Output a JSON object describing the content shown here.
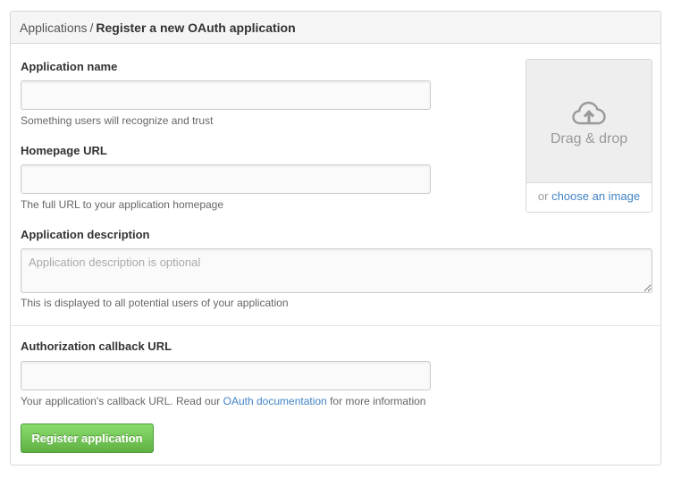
{
  "header": {
    "breadcrumb_parent": "Applications",
    "breadcrumb_separator": "/",
    "breadcrumb_current": "Register a new OAuth application"
  },
  "form": {
    "app_name": {
      "label": "Application name",
      "value": "",
      "placeholder": "",
      "note": "Something users will recognize and trust"
    },
    "homepage_url": {
      "label": "Homepage URL",
      "value": "",
      "placeholder": "",
      "note": "The full URL to your application homepage"
    },
    "description": {
      "label": "Application description",
      "value": "",
      "placeholder": "Application description is optional",
      "note": "This is displayed to all potential users of your application"
    },
    "callback_url": {
      "label": "Authorization callback URL",
      "value": "",
      "placeholder": "",
      "note_before": "Your application's callback URL. Read our",
      "note_link": "OAuth documentation",
      "note_after": "for more information"
    },
    "submit_label": "Register application"
  },
  "logo_upload": {
    "icon": "cloud-upload-icon",
    "drop_text": "Drag & drop",
    "or_text": "or",
    "choose_link": "choose an image"
  },
  "colors": {
    "link": "#4183c4",
    "button_top": "#8add6d",
    "button_bottom": "#60b044",
    "header_bg": "#f5f5f5"
  }
}
